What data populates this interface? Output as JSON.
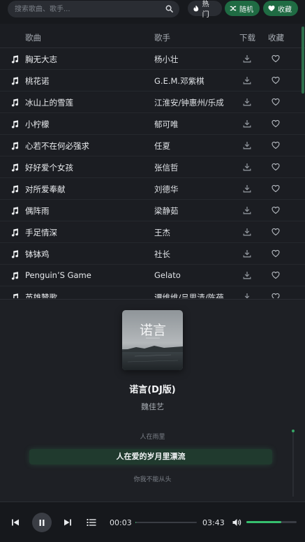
{
  "search": {
    "placeholder": "搜索歌曲、歌手...",
    "value": "",
    "icon": "search-icon"
  },
  "header_buttons": [
    {
      "label": "热门",
      "icon": "fire-icon"
    },
    {
      "label": "随机",
      "icon": "shuffle-icon"
    },
    {
      "label": "收藏",
      "icon": "heart-icon"
    }
  ],
  "list": {
    "columns": {
      "song": "歌曲",
      "artist": "歌手",
      "download": "下载",
      "favorite": "收藏"
    },
    "rows": [
      {
        "title": "胸无大志",
        "artist": "杨小壮"
      },
      {
        "title": "桃花诺",
        "artist": "G.E.M.邓紫棋"
      },
      {
        "title": "冰山上的雪莲",
        "artist": "江淮安/钟惠州/乐成"
      },
      {
        "title": "小柠檬",
        "artist": "郁可唯"
      },
      {
        "title": "心若不在何必强求",
        "artist": "任夏"
      },
      {
        "title": "好好爱个女孩",
        "artist": "张信哲"
      },
      {
        "title": "对所爱奉献",
        "artist": "刘德华"
      },
      {
        "title": "偶阵雨",
        "artist": "梁静茹"
      },
      {
        "title": "手足情深",
        "artist": "王杰"
      },
      {
        "title": "钵钵鸡",
        "artist": "社长"
      },
      {
        "title": "Penguin’S Game",
        "artist": "Gelato"
      },
      {
        "title": "英雄赞歌",
        "artist": "谭维维/吕思清/陈蓓"
      }
    ]
  },
  "now_playing": {
    "cover_text": "诺言",
    "title": "诺言(DJ版)",
    "artist": "魏佳艺",
    "lyrics": {
      "prev": "人在雨里",
      "current": "人在爱的岁月里漂流",
      "next": "你我不能从头"
    }
  },
  "controls": {
    "time_current": "00:03",
    "time_total": "03:43",
    "progress": 0.013,
    "volume": 0.7
  },
  "colors": {
    "accent": "#36a566",
    "accent_dark": "#1f6b43",
    "background": "#1b1d22"
  }
}
